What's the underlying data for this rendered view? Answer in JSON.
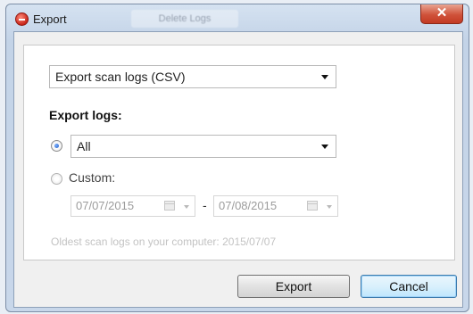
{
  "window": {
    "title": "Export",
    "background_tab_label": "Delete Logs",
    "close_glyph": "✕"
  },
  "format_select": {
    "selected": "Export scan logs (CSV)"
  },
  "export_logs": {
    "heading": "Export logs:",
    "option_all": {
      "selected_value": "All",
      "checked": true
    },
    "option_custom": {
      "label": "Custom:",
      "checked": false,
      "from_date": "07/07/2015",
      "to_date": "07/08/2015",
      "separator": "-"
    },
    "oldest_note": "Oldest scan logs on your computer: 2015/07/07"
  },
  "buttons": {
    "export_label": "Export",
    "cancel_label": "Cancel"
  },
  "colors": {
    "close_button": "#c9432c",
    "accent_radio": "#1d59c4",
    "disabled_text": "#c3c3c3"
  },
  "icons": [
    "app-icon",
    "close-icon",
    "dropdown-arrow-icon",
    "calendar-icon"
  ]
}
